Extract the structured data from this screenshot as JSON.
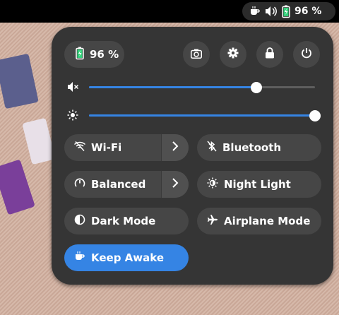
{
  "topbar": {
    "battery_text": "96 %"
  },
  "panel": {
    "battery_label": "96 %",
    "volume_level": 0.74,
    "brightness_level": 1.0,
    "tiles": [
      {
        "label": "Wi-Fi",
        "icon": "wifi-off-icon",
        "active": false,
        "has_arrow": true
      },
      {
        "label": "Bluetooth",
        "icon": "bluetooth-off-icon",
        "active": false,
        "has_arrow": false
      },
      {
        "label": "Balanced",
        "icon": "power-mode-icon",
        "active": false,
        "has_arrow": true
      },
      {
        "label": "Night Light",
        "icon": "night-light-icon",
        "active": false,
        "has_arrow": false
      },
      {
        "label": "Dark Mode",
        "icon": "dark-mode-icon",
        "active": false,
        "has_arrow": false
      },
      {
        "label": "Airplane Mode",
        "icon": "airplane-icon",
        "active": false,
        "has_arrow": false
      },
      {
        "label": "Keep Awake",
        "icon": "coffee-icon",
        "active": true,
        "has_arrow": false
      }
    ]
  },
  "colors": {
    "accent": "#3584e4",
    "panel_bg": "#353535",
    "tile_bg": "#464646"
  }
}
